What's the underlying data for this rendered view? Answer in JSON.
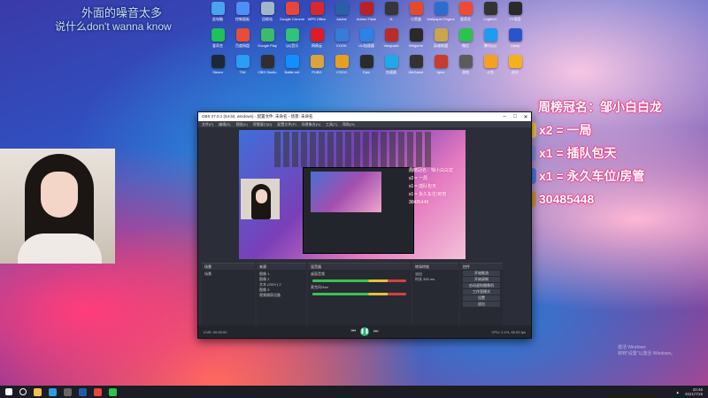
{
  "lyrics": {
    "line1": "外面的噪音太多",
    "line2": "说什么don't wanna know"
  },
  "desktop_icons": [
    {
      "label": "此电脑",
      "color": "#4aa3f0"
    },
    {
      "label": "控制面板",
      "color": "#4e8ef7"
    },
    {
      "label": "回收站",
      "color": "#9fb7c9"
    },
    {
      "label": "Google Chrome",
      "color": "#e8453c"
    },
    {
      "label": "WPS Office",
      "color": "#d8282f"
    },
    {
      "label": "Adobe",
      "color": "#2b5fa8"
    },
    {
      "label": "Adobe Flash",
      "color": "#ba2027"
    },
    {
      "label": "JL",
      "color": "#363636"
    },
    {
      "label": "小黑盒",
      "color": "#e44a2c"
    },
    {
      "label": "Wallpaper Engine",
      "color": "#2a6fd0"
    },
    {
      "label": "爱奇艺",
      "color": "#f14a34"
    },
    {
      "label": "Logitech",
      "color": "#333"
    },
    {
      "label": "YY语音",
      "color": "#2a2a2a"
    },
    {
      "label": "爱奇艺",
      "color": "#20c05a"
    },
    {
      "label": "百度网盘",
      "color": "#e84c3d"
    },
    {
      "label": "Google Play",
      "color": "#3dbb6a"
    },
    {
      "label": "QQ音乐",
      "color": "#31c27c"
    },
    {
      "label": "网易云",
      "color": "#dd1c28"
    },
    {
      "label": "KOOK",
      "color": "#3a7bd5"
    },
    {
      "label": "UU加速器",
      "color": "#2c82e6"
    },
    {
      "label": "Vanguard",
      "color": "#ba2b2b"
    },
    {
      "label": "Wegame",
      "color": "#2a2a2a"
    },
    {
      "label": "英雄联盟",
      "color": "#c9a64a"
    },
    {
      "label": "微信",
      "color": "#2fc14d"
    },
    {
      "label": "腾讯QQ",
      "color": "#1f9bf0"
    },
    {
      "label": "Uplay",
      "color": "#2855c9"
    },
    {
      "label": "Steam",
      "color": "#1b2838"
    },
    {
      "label": "TIM",
      "color": "#2a9df4"
    },
    {
      "label": "OBS Studio",
      "color": "#302e31"
    },
    {
      "label": "Battle.net",
      "color": "#148eff"
    },
    {
      "label": "PUBG",
      "color": "#d9a43b"
    },
    {
      "label": "CSGO",
      "color": "#e6a01f"
    },
    {
      "label": "Epic",
      "color": "#2a2a2a"
    },
    {
      "label": "加速器",
      "color": "#20a8e8"
    },
    {
      "label": "WeGame",
      "color": "#333"
    },
    {
      "label": "Apex",
      "color": "#c93a2f"
    },
    {
      "label": "游戏",
      "color": "#5b5b5b"
    },
    {
      "label": "斗鱼",
      "color": "#f4a020"
    },
    {
      "label": "虎牙",
      "color": "#f6b11a"
    }
  ],
  "overlay": {
    "title": "周榜冠名：邹小白白龙",
    "rows": [
      {
        "text": "x2 = 一局",
        "icon_color": "#f0c34a",
        "icon": "pencil-icon"
      },
      {
        "text": "x1 = 插队包天",
        "icon_color": "#7f8fe0",
        "icon": "rocket-icon"
      },
      {
        "text": "x1 = 永久车位/房管",
        "icon_color": "#4c79e0",
        "icon": "rocket-icon"
      },
      {
        "text": "30485448",
        "icon_color": "#c8953a",
        "icon": "owl-icon"
      }
    ]
  },
  "obs": {
    "title": "OBS 27.0.1 (64-bit, windows) - 配置文件: 未命名 - 场景: 未命名",
    "menu": [
      "文件(F)",
      "编辑(E)",
      "视图(V)",
      "停靠窗口(D)",
      "配置文件(P)",
      "场景集合(S)",
      "工具(T)",
      "帮助(H)"
    ],
    "preview_overlay": [
      "周榜冠名：邹小白白龙",
      "x2 = 一局",
      "x1 = 插队包天",
      "x1 = 永久车位/房管",
      "30485448"
    ],
    "docks": {
      "scenes": {
        "header": "场景",
        "items": [
          "场景"
        ]
      },
      "sources": {
        "header": "来源",
        "items": [
          "图像 1",
          "图像 2",
          "文本 (GDI+) 2",
          "图像 3",
          "视频捕获设备"
        ]
      },
      "mixer": {
        "header": "混音器",
        "items": [
          "桌面音频",
          "麦克风/Aux"
        ],
        "levels": [
          "0.0 dB",
          "0.0 dB"
        ]
      },
      "transitions": {
        "header": "转场特效",
        "items": [
          "淡出",
          "时长 300 ms"
        ]
      },
      "controls": {
        "header": "控件",
        "items": [
          "开始推流",
          "开始录制",
          "启动虚拟摄像机",
          "工作室模式",
          "设置",
          "退出"
        ]
      }
    },
    "status": {
      "live": "LIVE: 00:00:00",
      "rec": "REC: 00:00:00",
      "cpu": "CPU: 2.1%, 60.00 fps"
    }
  },
  "watermark": {
    "line1": "激活 Windows",
    "line2": "转到“设置”以激活 Windows。"
  },
  "taskbar": {
    "icons": [
      {
        "name": "start-icon",
        "color": "#ffffff"
      },
      {
        "name": "search-icon",
        "color": "#ffffff"
      },
      {
        "name": "file-explorer-icon",
        "color": "#f3c14b"
      },
      {
        "name": "edge-icon",
        "color": "#2e9be0"
      },
      {
        "name": "obs-icon",
        "color": "#444"
      },
      {
        "name": "steam-icon",
        "color": "#1b5fa8"
      },
      {
        "name": "chrome-icon",
        "color": "#e8453c"
      },
      {
        "name": "wechat-icon",
        "color": "#2fc14d"
      }
    ],
    "tray": {
      "time": "20:46",
      "date": "2021/7/15"
    }
  }
}
